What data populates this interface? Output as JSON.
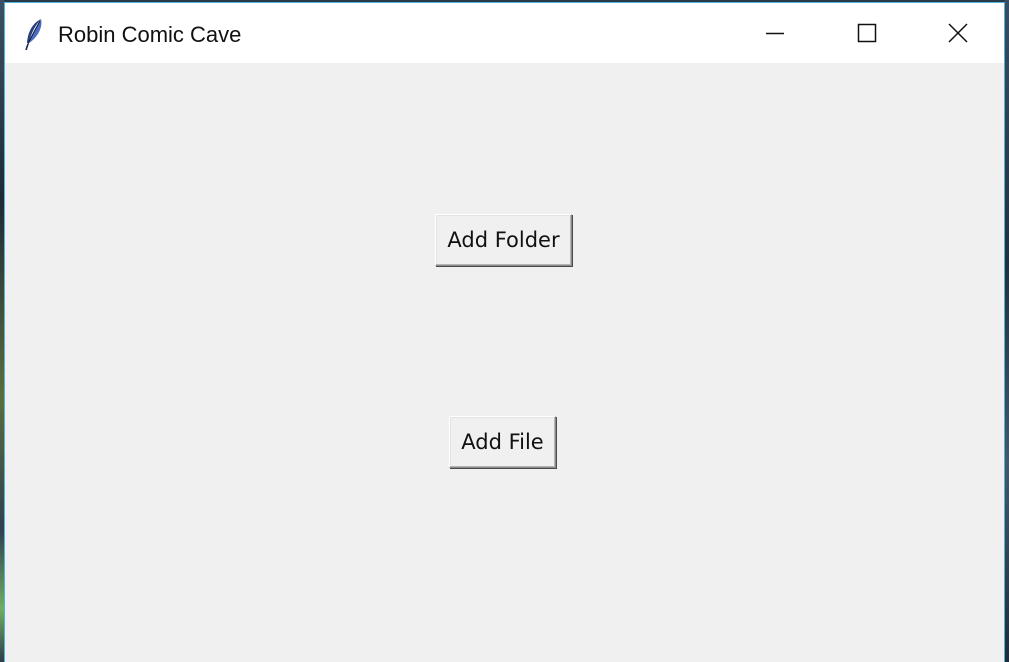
{
  "window": {
    "title": "Robin Comic Cave",
    "app_icon": "feather-icon",
    "controls": {
      "minimize": "minimize-icon",
      "maximize": "maximize-icon",
      "close": "close-icon"
    }
  },
  "main": {
    "add_folder_label": "Add Folder",
    "add_file_label": "Add File"
  },
  "colors": {
    "titlebar": "#ffffff",
    "client_background": "#f0f0f0",
    "window_border": "#4fb4d8"
  }
}
